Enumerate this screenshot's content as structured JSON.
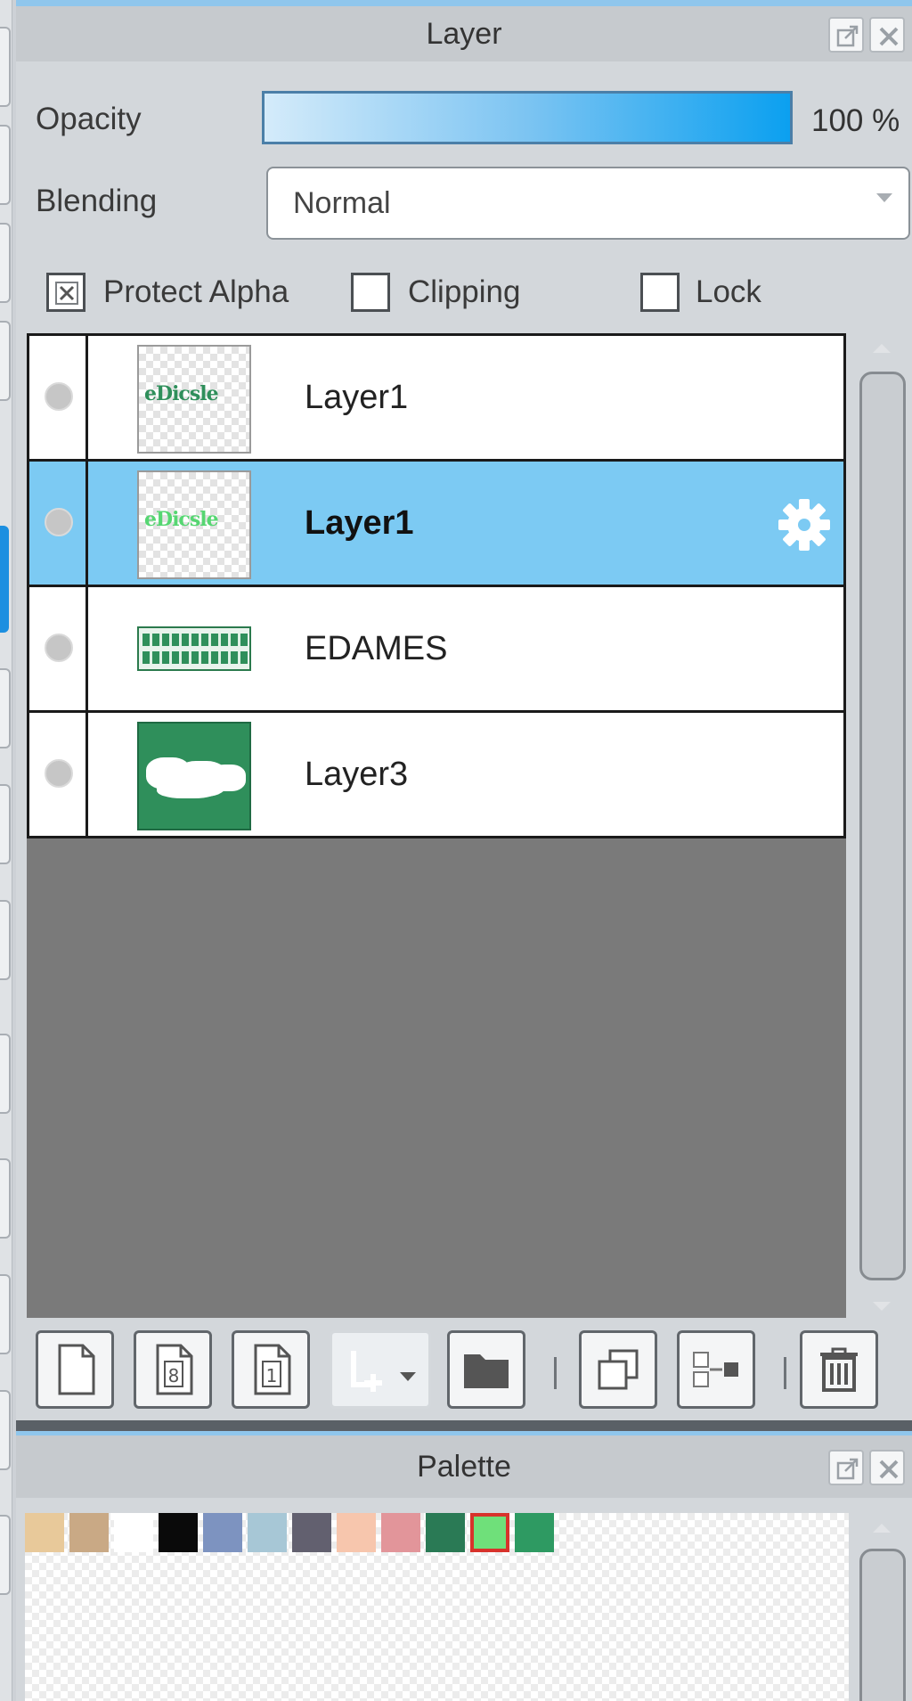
{
  "layer_panel": {
    "title": "Layer",
    "opacity_label": "Opacity",
    "opacity_value": "100 %",
    "opacity_fraction": 1.0,
    "blending_label": "Blending",
    "blending_value": "Normal",
    "protect_alpha": {
      "label": "Protect Alpha",
      "checked": true
    },
    "clipping": {
      "label": "Clipping",
      "checked": false
    },
    "lock": {
      "label": "Lock",
      "checked": false
    },
    "layers": [
      {
        "name": "Layer1",
        "thumb": "text-dark",
        "selected": false
      },
      {
        "name": "Layer1",
        "thumb": "text-light",
        "selected": true
      },
      {
        "name": "EDAMES",
        "thumb": "banner",
        "selected": false
      },
      {
        "name": "Layer3",
        "thumb": "green-blob",
        "selected": false
      }
    ],
    "selected_row_color": "#7ccaf3",
    "toolbar": [
      {
        "icon": "new-layer-icon"
      },
      {
        "icon": "new-8bit-layer-icon"
      },
      {
        "icon": "new-1bit-layer-icon"
      },
      {
        "icon": "add-layer-dropdown-icon",
        "disabled": true
      },
      {
        "icon": "folder-icon"
      },
      {
        "icon": "duplicate-layer-icon"
      },
      {
        "icon": "merge-down-icon"
      },
      {
        "icon": "trash-icon"
      }
    ]
  },
  "palette_panel": {
    "title": "Palette",
    "swatches": [
      "#e8c99a",
      "#c9a985",
      "#ffffff",
      "#0a0a0a",
      "#7d93c0",
      "#a7c7d6",
      "#62606f",
      "#f7c6ad",
      "#e2959a",
      "#2a7a55",
      "#6fe07a",
      "#2e9a62"
    ],
    "selected_swatch_index": 10,
    "selected_swatch_border": "#d8322b"
  },
  "colors": {
    "accent": "#1c8fe0",
    "panel_bg": "#d3d7db",
    "list_bg": "#7a7a7a"
  }
}
